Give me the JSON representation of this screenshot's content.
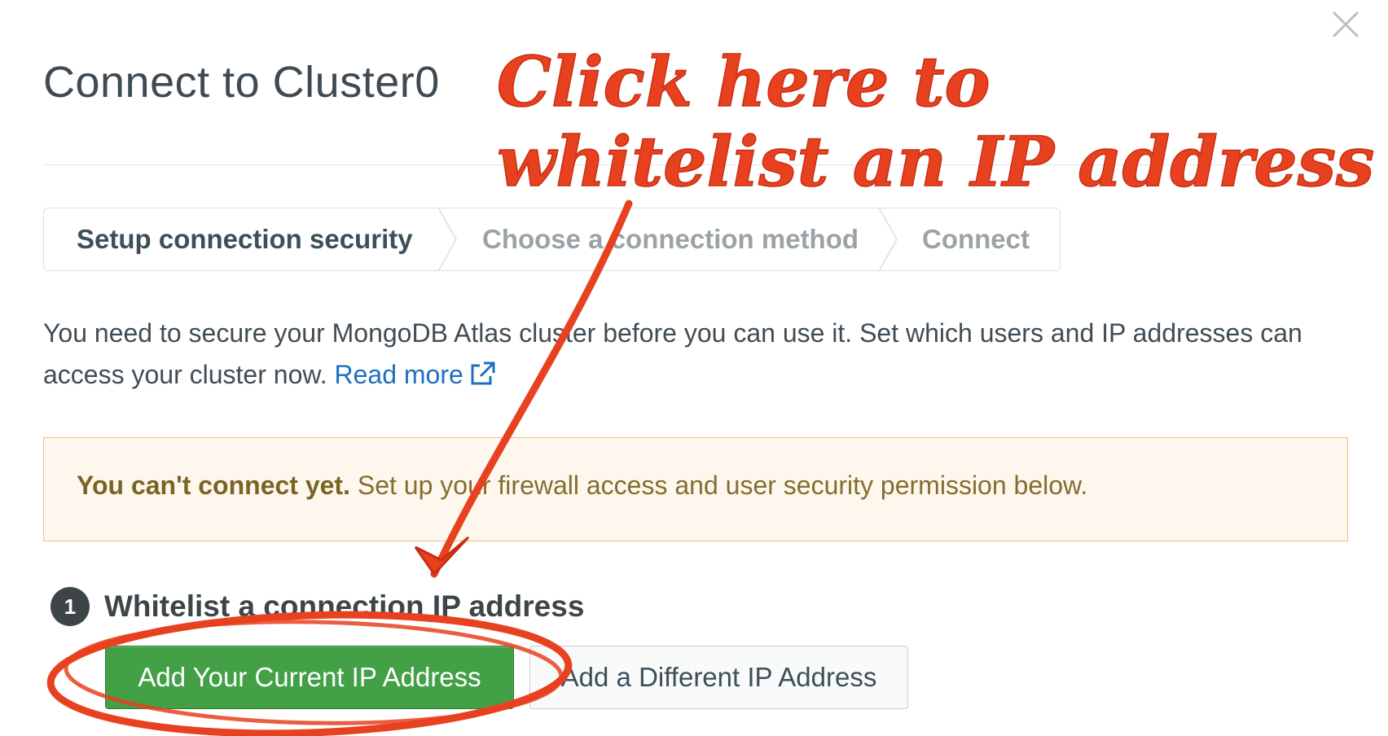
{
  "modal": {
    "title": "Connect to Cluster0",
    "close_icon": "close-icon"
  },
  "steps": [
    {
      "label": "Setup connection security",
      "state": "active"
    },
    {
      "label": "Choose a connection method",
      "state": "inactive"
    },
    {
      "label": "Connect",
      "state": "inactive"
    }
  ],
  "intro": {
    "text": "You need to secure your MongoDB Atlas cluster before you can use it. Set which users and IP addresses can access your cluster now.",
    "link_label": "Read more",
    "link_icon": "external-link-icon"
  },
  "warning": {
    "bold": "You can't connect yet.",
    "text": " Set up your firewall access and user security permission below."
  },
  "section": {
    "number": "1",
    "title": "Whitelist a connection IP address"
  },
  "buttons": {
    "primary": "Add Your Current IP Address",
    "secondary": "Add a Different IP Address"
  },
  "annotation": {
    "line1": "Click here to",
    "line2": "whitelist an IP address"
  },
  "colors": {
    "primary_button": "#43a047",
    "link": "#1d6fbf",
    "warning_bg": "#fef7ee",
    "warning_border": "#f3bf7e",
    "annotation": "#e8411f"
  }
}
